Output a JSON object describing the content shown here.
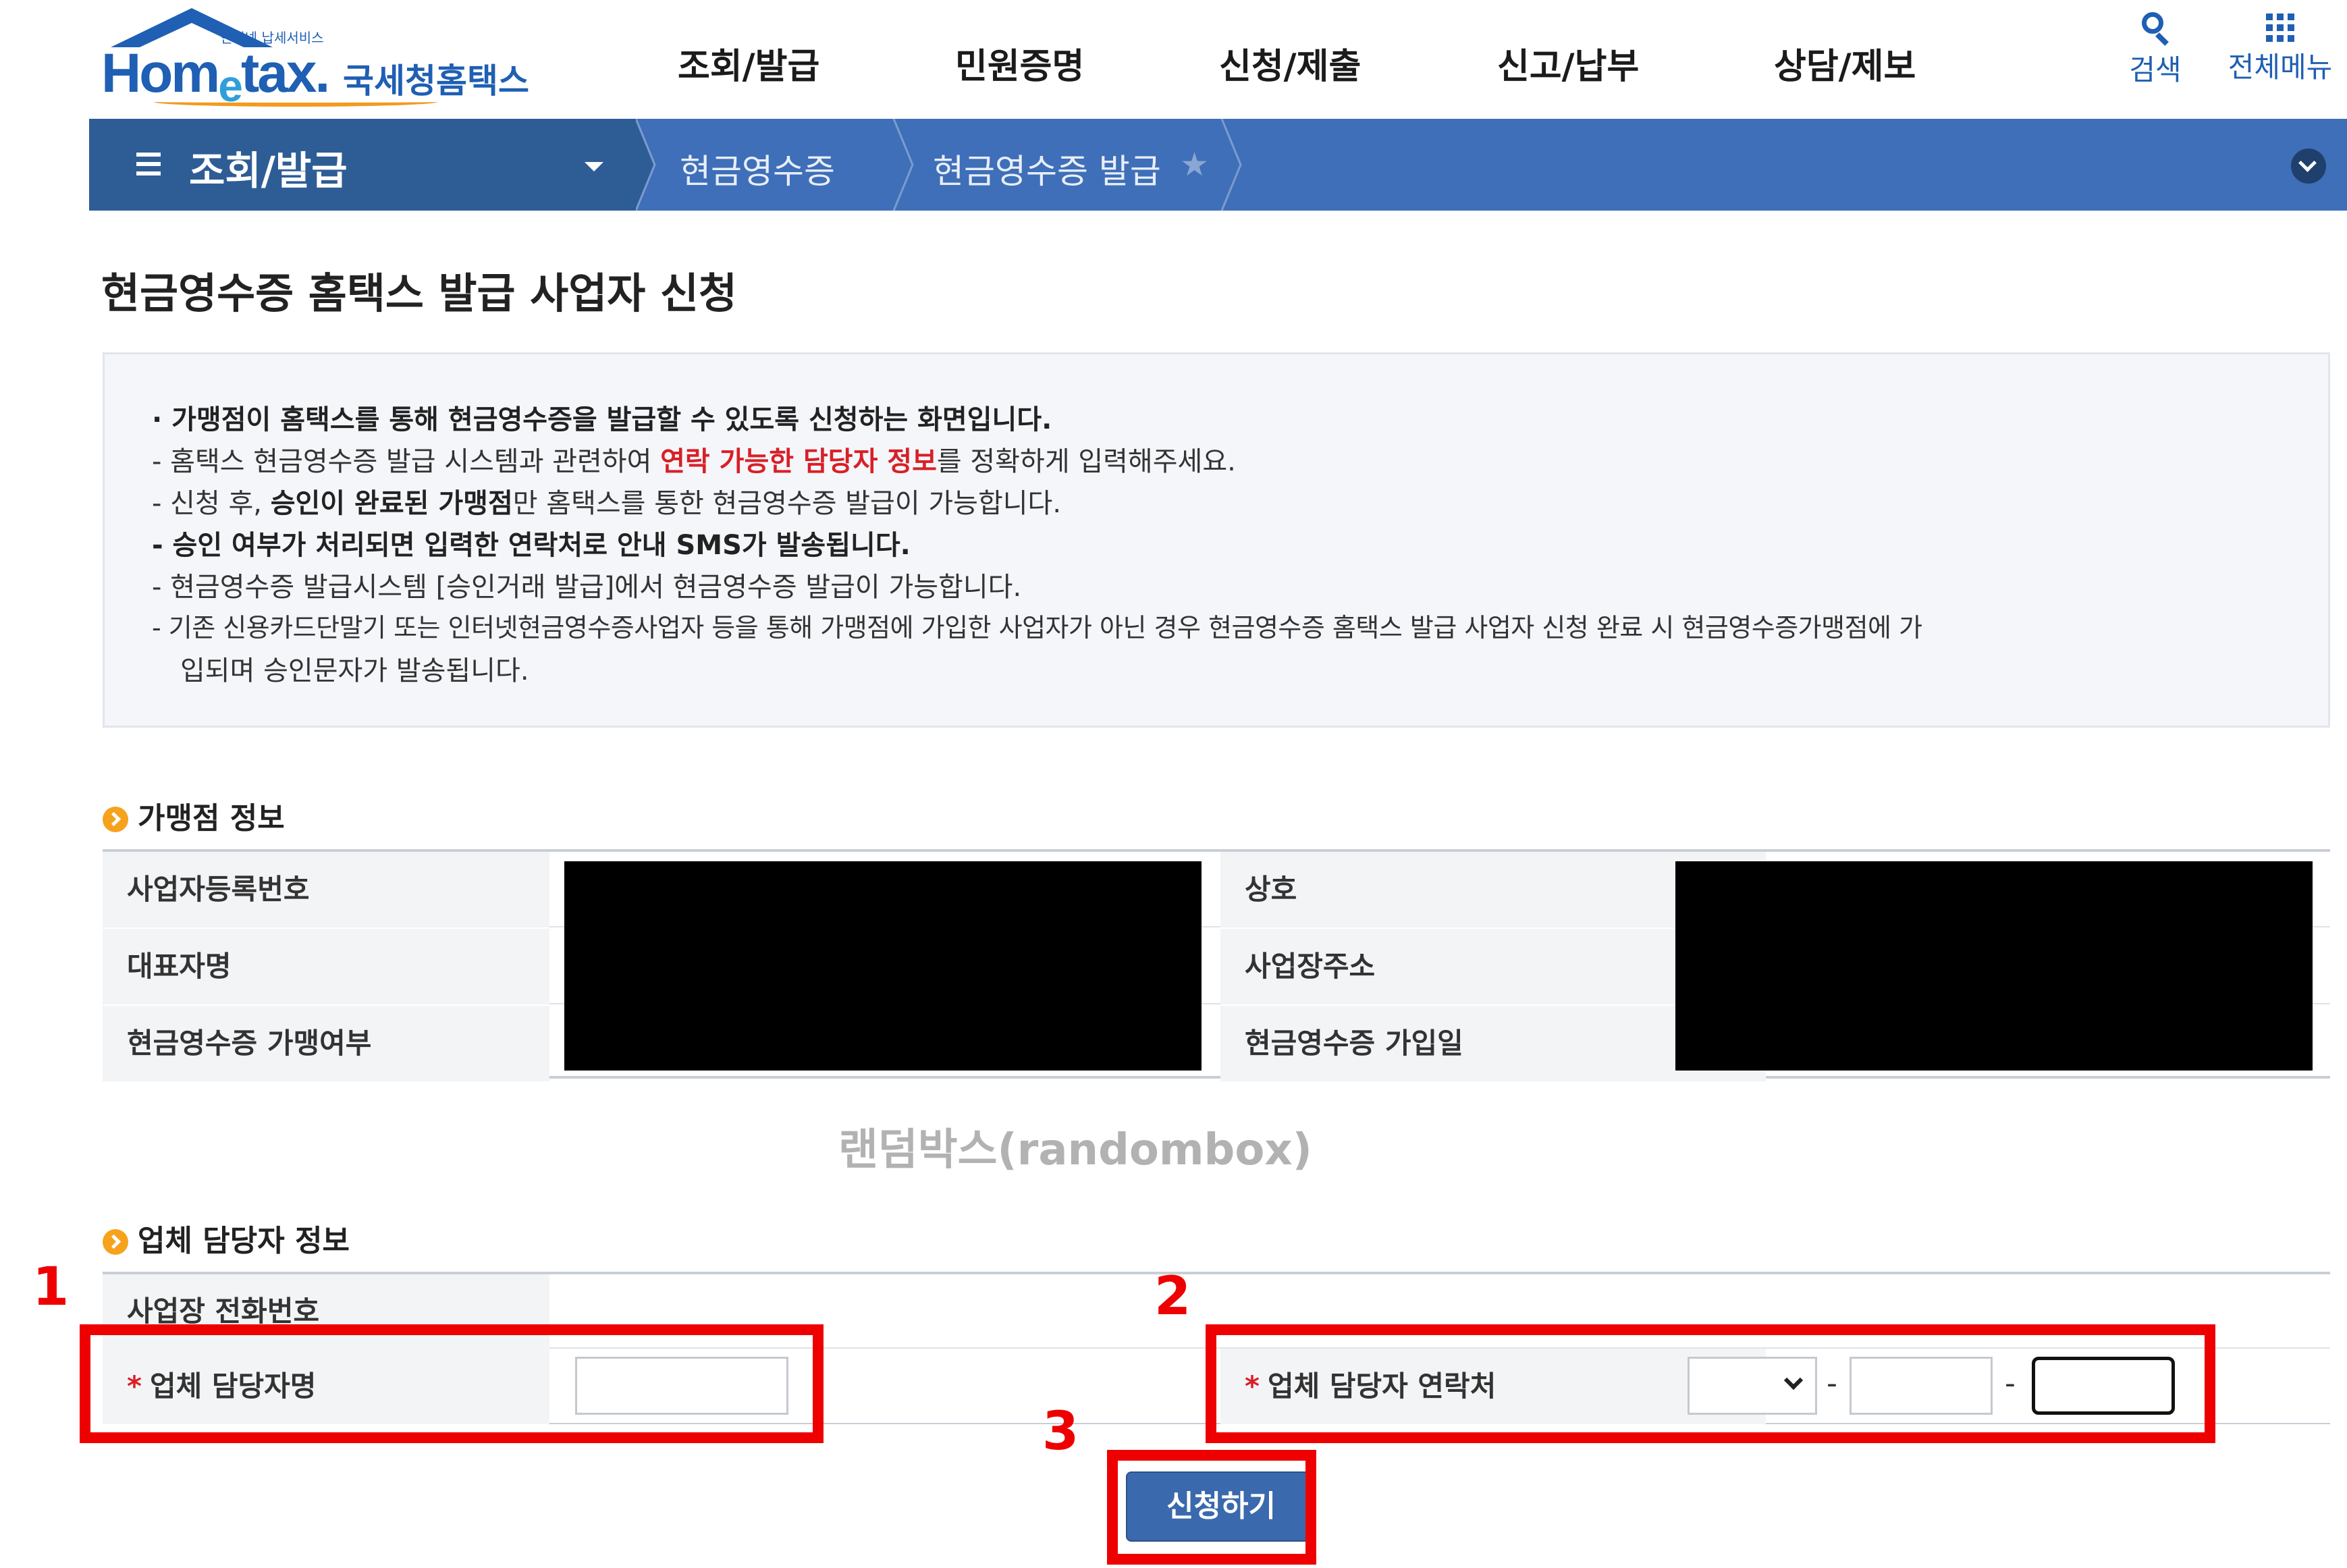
{
  "header": {
    "logo": {
      "service_text": "인터넷 납세서비스",
      "wordmark_pre": "Hom",
      "wordmark_e": "e",
      "wordmark_post": "tax.",
      "korean_name": "국세청홈택스"
    },
    "nav": [
      "조회/발급",
      "민원증명",
      "신청/제출",
      "신고/납부",
      "상담/제보"
    ],
    "search_label": "검색",
    "all_menu_label": "전체메뉴"
  },
  "breadcrumb": {
    "menu": "조회/발급",
    "level2": "현금영수증",
    "level3": "현금영수증 발급"
  },
  "page": {
    "title": "현금영수증 홈택스 발급 사업자 신청",
    "notice": {
      "line1": "· 가맹점이 홈택스를 통해 현금영수증을 발급할 수 있도록 신청하는 화면입니다.",
      "line2_a": "- 홈택스 현금영수증 발급 시스템과 관련하여 ",
      "line2_red": "연락 가능한 담당자 정보",
      "line2_b": "를 정확하게 입력해주세요.",
      "line3_a": "- 신청 후, ",
      "line3_bold": "승인이 완료된 가맹점",
      "line3_b": "만 홈택스를 통한 현금영수증 발급이 가능합니다.",
      "line4": "- 승인 여부가 처리되면 입력한 연락처로 안내 SMS가 발송됩니다.",
      "line5": "- 현금영수증 발급시스템 [승인거래 발급]에서 현금영수증 발급이 가능합니다.",
      "line6": "- 기존 신용카드단말기 또는 인터넷현금영수증사업자 등을 통해 가맹점에 가입한 사업자가 아닌 경우 현금영수증 홈택스 발급 사업자 신청 완료 시 현금영수증가맹점에 가",
      "line7": "입되며 승인문자가 발송됩니다."
    }
  },
  "merchant_info": {
    "heading": "가맹점 정보",
    "labels": {
      "biz_reg_no": "사업자등록번호",
      "trade_name": "상호",
      "representative": "대표자명",
      "biz_address": "사업장주소",
      "cash_receipt_member": "현금영수증 가맹여부",
      "join_date": "현금영수증 가입일"
    }
  },
  "watermark": "랜덤박스(randombox)",
  "contact_info": {
    "heading": "업체 담당자 정보",
    "phone_label": "사업장 전화번호",
    "name_label": "업체 담당자명",
    "contact_label": "업체 담당자 연락처",
    "required_mark": "*",
    "dash": "-",
    "name_value": "",
    "phone_part2": "",
    "phone_part3": ""
  },
  "apply_button": "신청하기",
  "annotations": [
    "1",
    "2",
    "3"
  ],
  "colors": {
    "brand_blue": "#1f5fb4",
    "crumb_dark": "#2e5d96",
    "crumb_light": "#3f6fb8",
    "accent_orange": "#f6a21d",
    "required_red": "#d91f26",
    "annotation_red": "#ee0000",
    "button_blue": "#3a69ad"
  }
}
